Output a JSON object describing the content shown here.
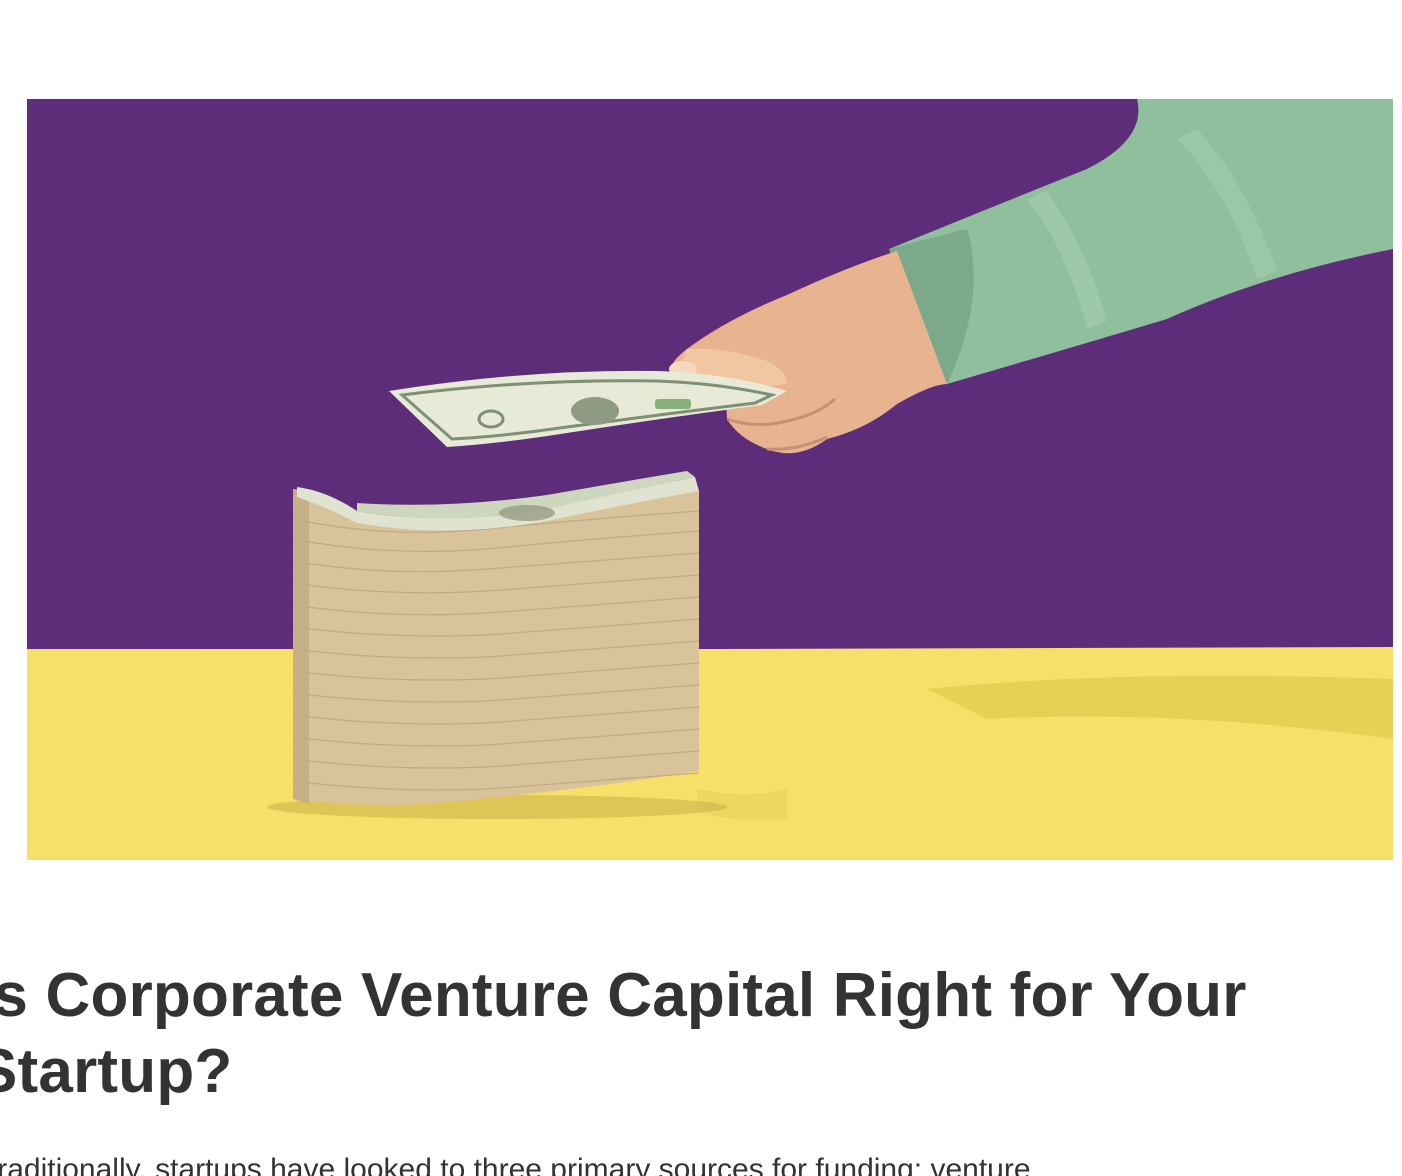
{
  "hero_image": {
    "alt": "",
    "colors": {
      "background": "#5e2d7a",
      "table": "#f6df5d",
      "sleeve": "#8fbf9c",
      "bills": "#d7c29a",
      "banknote": "#e8ead8"
    }
  },
  "article": {
    "title": "Is Corporate Venture Capital Right for Your Startup?",
    "lead": "Traditionally, startups have looked to three primary sources for funding: venture"
  }
}
